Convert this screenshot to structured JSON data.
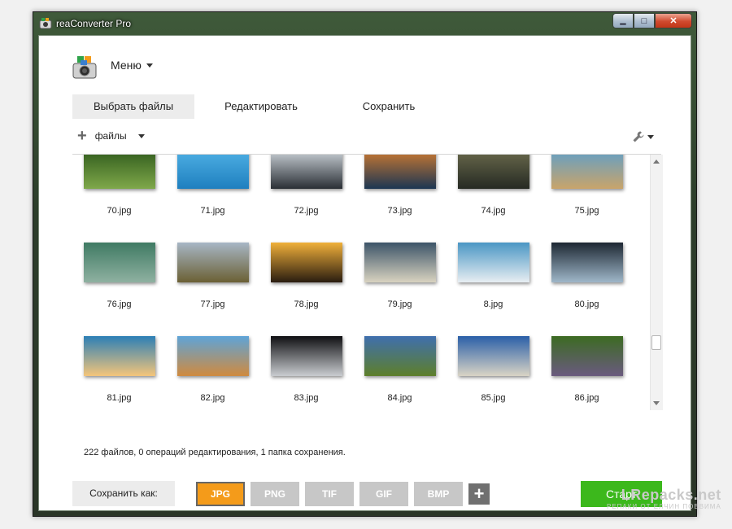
{
  "window": {
    "title": "reaConverter Pro",
    "controls": {
      "minimize": "▁",
      "maximize": "□",
      "close": "✕"
    }
  },
  "header": {
    "menu_label": "Меню"
  },
  "tabs": [
    {
      "label": "Выбрать файлы",
      "active": true
    },
    {
      "label": "Редактировать",
      "active": false
    },
    {
      "label": "Сохранить",
      "active": false
    }
  ],
  "toolbar": {
    "files_label": "файлы"
  },
  "files": [
    {
      "name": "70.jpg",
      "colors": [
        "#2f5a1c",
        "#7fa84a"
      ]
    },
    {
      "name": "71.jpg",
      "colors": [
        "#4fb1e5",
        "#1f7fbf"
      ]
    },
    {
      "name": "72.jpg",
      "colors": [
        "#cfd6dc",
        "#2a2f35"
      ]
    },
    {
      "name": "73.jpg",
      "colors": [
        "#d07b30",
        "#1c3652"
      ]
    },
    {
      "name": "74.jpg",
      "colors": [
        "#6b6b4d",
        "#262a23"
      ]
    },
    {
      "name": "75.jpg",
      "colors": [
        "#5f9fc9",
        "#c9a46a"
      ]
    },
    {
      "name": "76.jpg",
      "colors": [
        "#3f7a63",
        "#8fb1a1"
      ]
    },
    {
      "name": "77.jpg",
      "colors": [
        "#a7b6c5",
        "#6b6034"
      ]
    },
    {
      "name": "78.jpg",
      "colors": [
        "#f0b03a",
        "#2a1c10"
      ]
    },
    {
      "name": "79.jpg",
      "colors": [
        "#3c5468",
        "#d9d3c0"
      ]
    },
    {
      "name": "8.jpg",
      "colors": [
        "#4a96c4",
        "#e8eef2"
      ]
    },
    {
      "name": "80.jpg",
      "colors": [
        "#1d2732",
        "#9fb7c9"
      ]
    },
    {
      "name": "81.jpg",
      "colors": [
        "#2c7fb6",
        "#f4c57a"
      ]
    },
    {
      "name": "82.jpg",
      "colors": [
        "#5ea4d8",
        "#d08a3e"
      ]
    },
    {
      "name": "83.jpg",
      "colors": [
        "#0f0f12",
        "#c9ccd0"
      ]
    },
    {
      "name": "84.jpg",
      "colors": [
        "#3f6fae",
        "#5e7f2a"
      ]
    },
    {
      "name": "85.jpg",
      "colors": [
        "#2a5fa8",
        "#d9d4c5"
      ]
    },
    {
      "name": "86.jpg",
      "colors": [
        "#3c6b22",
        "#6a5a7f"
      ]
    }
  ],
  "status": "222 файлов, 0 операций редактирования, 1 папка сохранения.",
  "save_as_label": "Сохранить как:",
  "formats": [
    {
      "label": "JPG",
      "active": true
    },
    {
      "label": "PNG",
      "active": false
    },
    {
      "label": "TIF",
      "active": false
    },
    {
      "label": "GIF",
      "active": false
    },
    {
      "label": "BMP",
      "active": false
    }
  ],
  "add_format": "+",
  "start_label": "Старт",
  "watermark": {
    "line1": "LRepacks.net",
    "line2": "РЕПАКИ ОТ ЕЛЧИН ПОВВИМА"
  },
  "colors": {
    "accent_format": "#f49b1a",
    "start": "#3cb81c"
  }
}
